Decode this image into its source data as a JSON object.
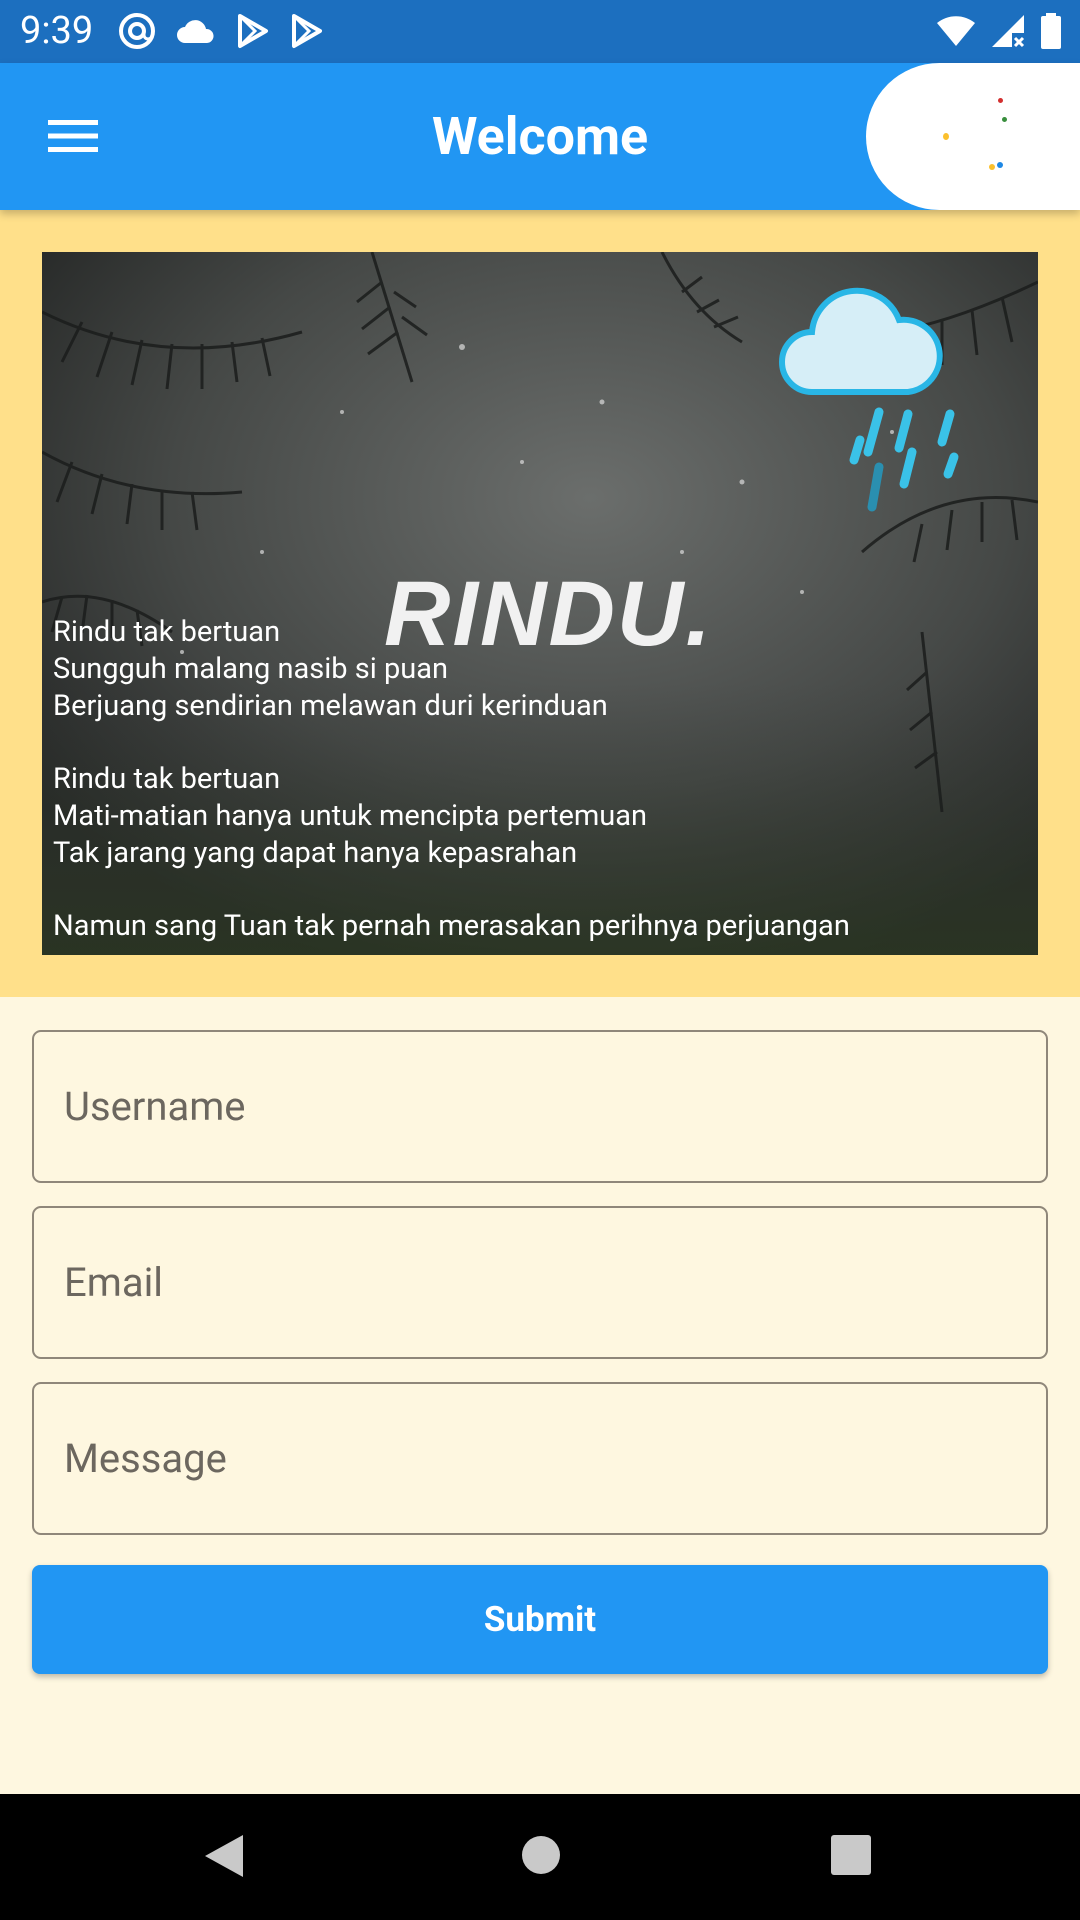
{
  "status_bar": {
    "time": "9:39",
    "left_icons": [
      "at-sign-icon",
      "cloud-icon",
      "play-store-icon",
      "play-store-icon"
    ],
    "right_icons": [
      "wifi-icon",
      "signal-icon",
      "battery-icon"
    ]
  },
  "app_bar": {
    "title": "Welcome",
    "menu_icon": "hamburger-menu-icon",
    "color": "#2196F3"
  },
  "banner": {
    "word": "RINDU.",
    "poem_stanzas": [
      [
        "Rindu tak bertuan",
        "Sungguh malang nasib si puan",
        "Berjuang sendirian melawan duri kerinduan"
      ],
      [
        "Rindu tak bertuan",
        "Mati-matian hanya untuk mencipta pertemuan",
        "Tak jarang yang dapat hanya kepasrahan"
      ],
      [
        "Namun sang Tuan tak pernah merasakan perihnya perjuangan"
      ]
    ],
    "background_color": "#FFE08A"
  },
  "form": {
    "username_placeholder": "Username",
    "email_placeholder": "Email",
    "message_placeholder": "Message",
    "submit_label": "Submit"
  },
  "nav_bar": {
    "icons": [
      "back-icon",
      "home-icon",
      "recents-icon"
    ]
  }
}
